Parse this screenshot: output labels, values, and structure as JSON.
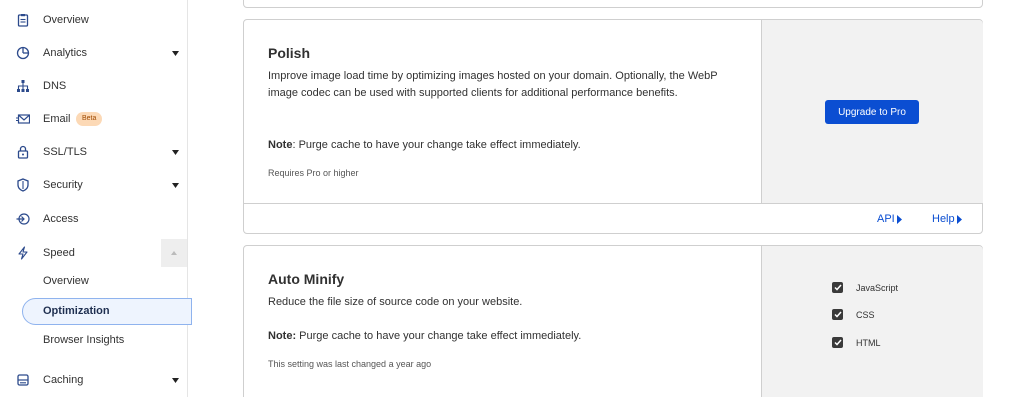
{
  "sidebar": {
    "items": [
      {
        "label": "Overview",
        "icon": "clipboard-icon"
      },
      {
        "label": "Analytics",
        "icon": "pie-chart-icon",
        "caret": true
      },
      {
        "label": "DNS",
        "icon": "network-icon"
      },
      {
        "label": "Email",
        "icon": "envelope-icon",
        "badge": "Beta"
      },
      {
        "label": "SSL/TLS",
        "icon": "lock-icon",
        "caret": true
      },
      {
        "label": "Security",
        "icon": "shield-icon",
        "caret": true
      },
      {
        "label": "Access",
        "icon": "login-icon"
      },
      {
        "label": "Speed",
        "icon": "lightning-icon",
        "expanded": true
      },
      {
        "label": "Caching",
        "icon": "storage-icon",
        "caret": true
      }
    ],
    "speed_sub": [
      "Overview",
      "Optimization",
      "Browser Insights"
    ],
    "active_sub": "Optimization"
  },
  "polish": {
    "title": "Polish",
    "description": "Improve image load time by optimizing images hosted on your domain. Optionally, the WebP image codec can be used with supported clients for additional performance benefits.",
    "note_label": "Note",
    "note_text": ": Purge cache to have your change take effect immediately.",
    "meta": "Requires Pro or higher",
    "upgrade_label": "Upgrade to Pro",
    "api_label": "API",
    "help_label": "Help"
  },
  "minify": {
    "title": "Auto Minify",
    "description": "Reduce the file size of source code on your website.",
    "note_label": "Note:",
    "note_text": " Purge cache to have your change take effect immediately.",
    "meta": "This setting was last changed a year ago",
    "options": [
      {
        "label": "JavaScript",
        "checked": true
      },
      {
        "label": "CSS",
        "checked": true
      },
      {
        "label": "HTML",
        "checked": true
      }
    ]
  },
  "colors": {
    "accent": "#0b4ed2",
    "badge_bg": "#fcd9b6",
    "side_panel": "#f2f2f2"
  }
}
